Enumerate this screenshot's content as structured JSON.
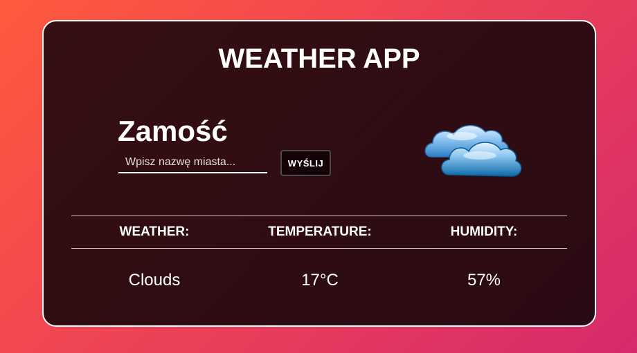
{
  "app": {
    "title": "WEATHER APP"
  },
  "location": {
    "city": "Zamość"
  },
  "search": {
    "placeholder": "Wpisz nazwę miasta...",
    "value": "",
    "submit_label": "WYŚLIJ"
  },
  "icon": {
    "name": "clouds-icon"
  },
  "stats": {
    "weather_label": "WEATHER:",
    "weather_value": "Clouds",
    "temperature_label": "TEMPERATURE:",
    "temperature_value": "17°C",
    "humidity_label": "HUMIDITY:",
    "humidity_value": "57%"
  },
  "colors": {
    "background_start": "#ff5a3c",
    "background_end": "#d52a6c",
    "card": "#2e0c12",
    "text": "#ffffff"
  }
}
